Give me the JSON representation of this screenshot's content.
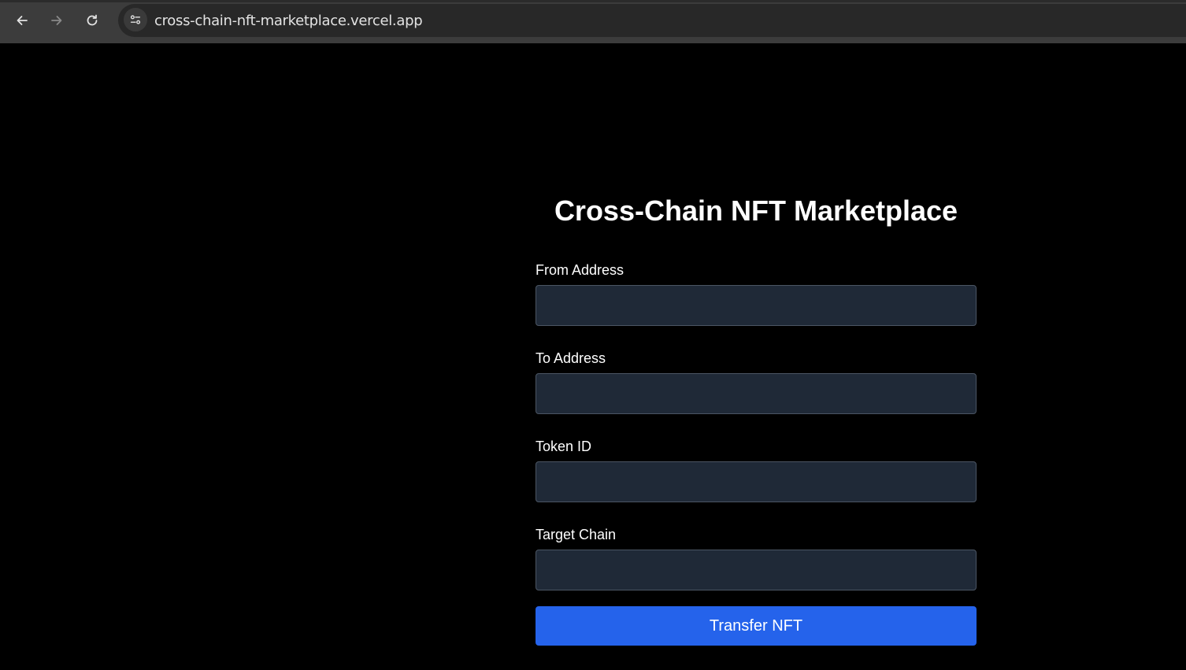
{
  "browser": {
    "url": "cross-chain-nft-marketplace.vercel.app",
    "icons": {
      "back": "arrow-left-icon",
      "forward": "arrow-right-icon",
      "reload": "reload-icon",
      "site_info": "tune-icon"
    }
  },
  "page": {
    "title": "Cross-Chain NFT Marketplace",
    "fields": [
      {
        "label": "From Address",
        "value": ""
      },
      {
        "label": "To Address",
        "value": ""
      },
      {
        "label": "Token ID",
        "value": ""
      },
      {
        "label": "Target Chain",
        "value": ""
      }
    ],
    "submit_label": "Transfer NFT"
  },
  "colors": {
    "page_background": "#000000",
    "input_background": "#1f2937",
    "button_background": "#2563eb",
    "text": "#ffffff"
  }
}
